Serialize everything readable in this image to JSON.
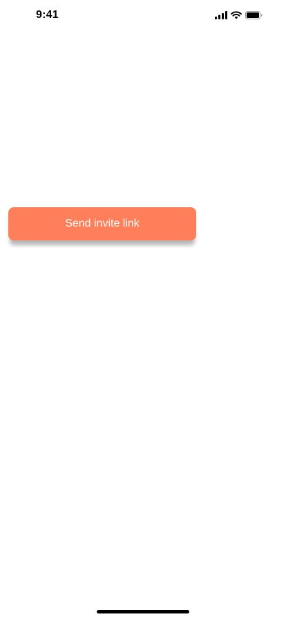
{
  "status_bar": {
    "time": "9:41",
    "icons": [
      "signal-icon",
      "wifi-icon",
      "battery-icon"
    ]
  },
  "main": {
    "invite_button_label": "Send invite link"
  },
  "colors": {
    "accent": "#FF7F5A",
    "background": "#FFFFFF",
    "button_text": "#FFFFFF"
  }
}
